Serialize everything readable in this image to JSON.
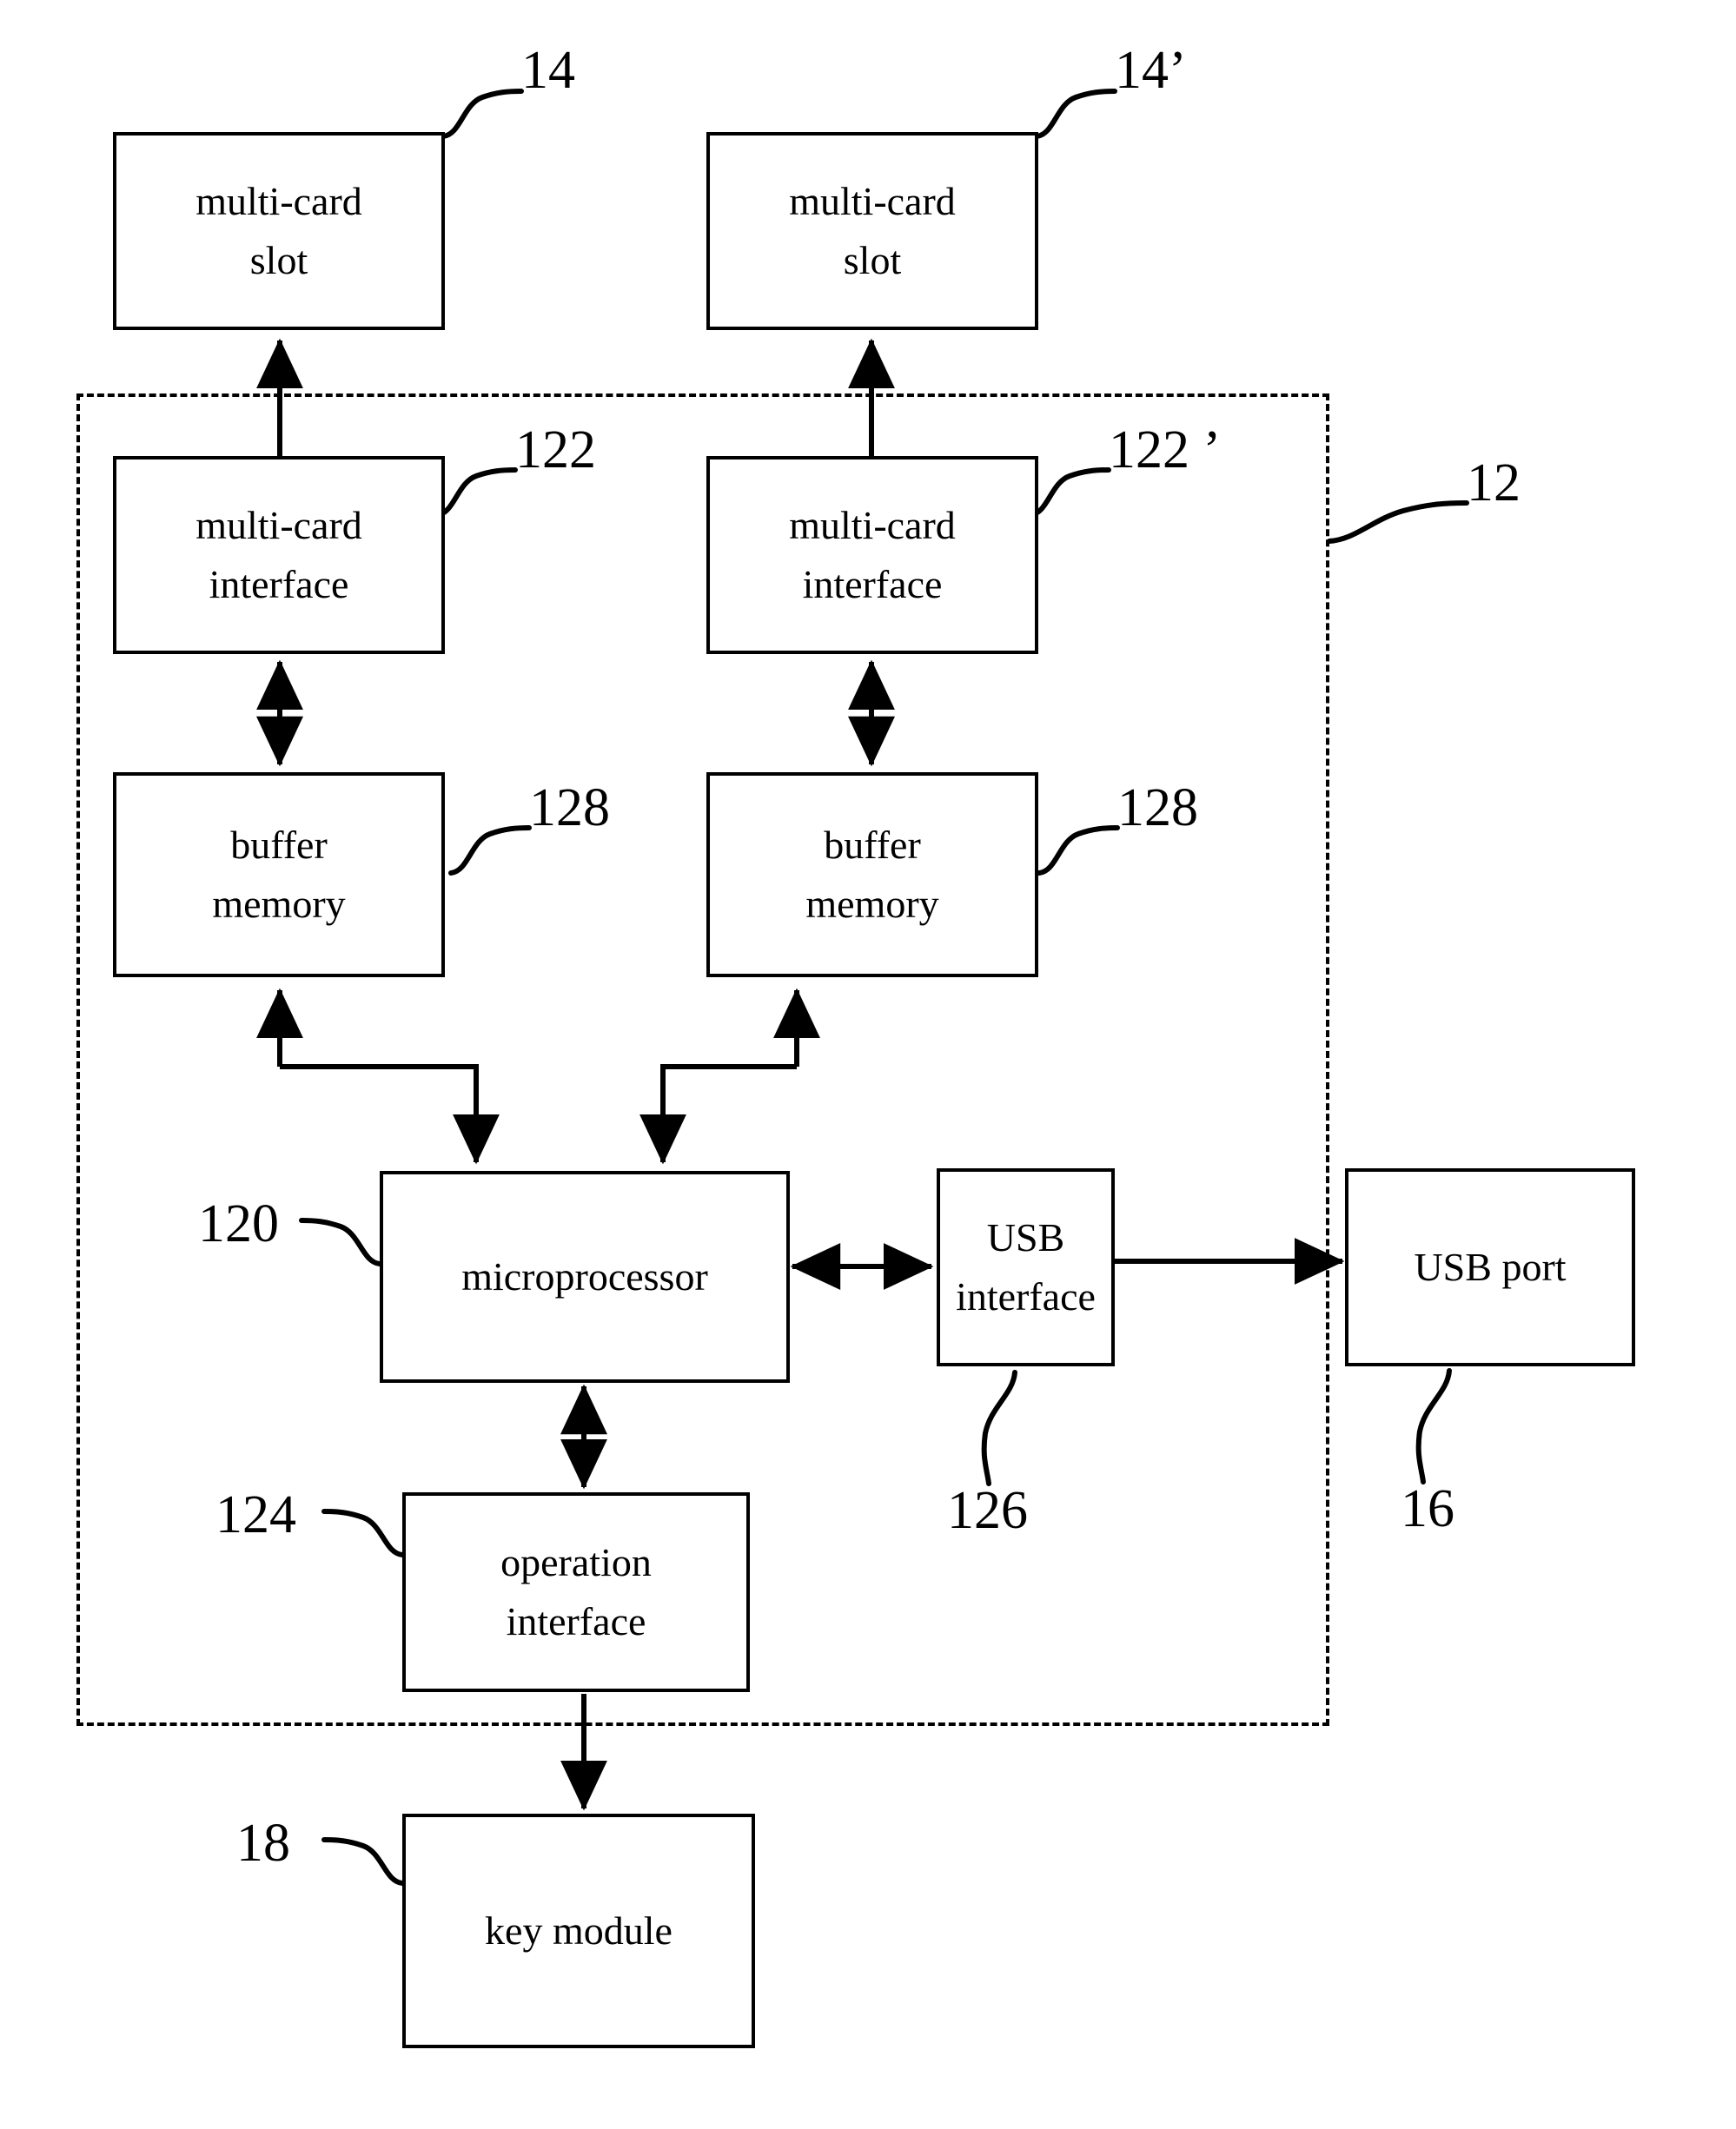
{
  "figure": {
    "type": "patent-block-diagram",
    "background_color": "#ffffff",
    "line_color": "#000000"
  },
  "blocks": {
    "multi_card_slot_left": {
      "line1": "multi-card",
      "line2": "slot"
    },
    "multi_card_slot_right": {
      "line1": "multi-card",
      "line2": "slot"
    },
    "multi_card_interface_left": {
      "line1": "multi-card",
      "line2": "interface"
    },
    "multi_card_interface_right": {
      "line1": "multi-card",
      "line2": "interface"
    },
    "buffer_memory_left": {
      "line1": "buffer",
      "line2": "memory"
    },
    "buffer_memory_right": {
      "line1": "buffer",
      "line2": "memory"
    },
    "microprocessor": {
      "line1": "microprocessor",
      "line2": ""
    },
    "usb_interface": {
      "line1": "USB",
      "line2": "interface"
    },
    "usb_port": {
      "line1": "USB port",
      "line2": ""
    },
    "operation_interface": {
      "line1": "operation",
      "line2": "interface"
    },
    "key_module": {
      "line1": "key module",
      "line2": ""
    }
  },
  "reference_numerals": {
    "slot_left": "14",
    "slot_right": "14’",
    "interface_left": "122",
    "interface_right": "122 ’",
    "buffer_left": "128",
    "buffer_right": "128",
    "enclosure": "12",
    "microprocessor": "120",
    "usb_interface": "126",
    "usb_port": "16",
    "operation_interface": "124",
    "key_module": "18"
  }
}
